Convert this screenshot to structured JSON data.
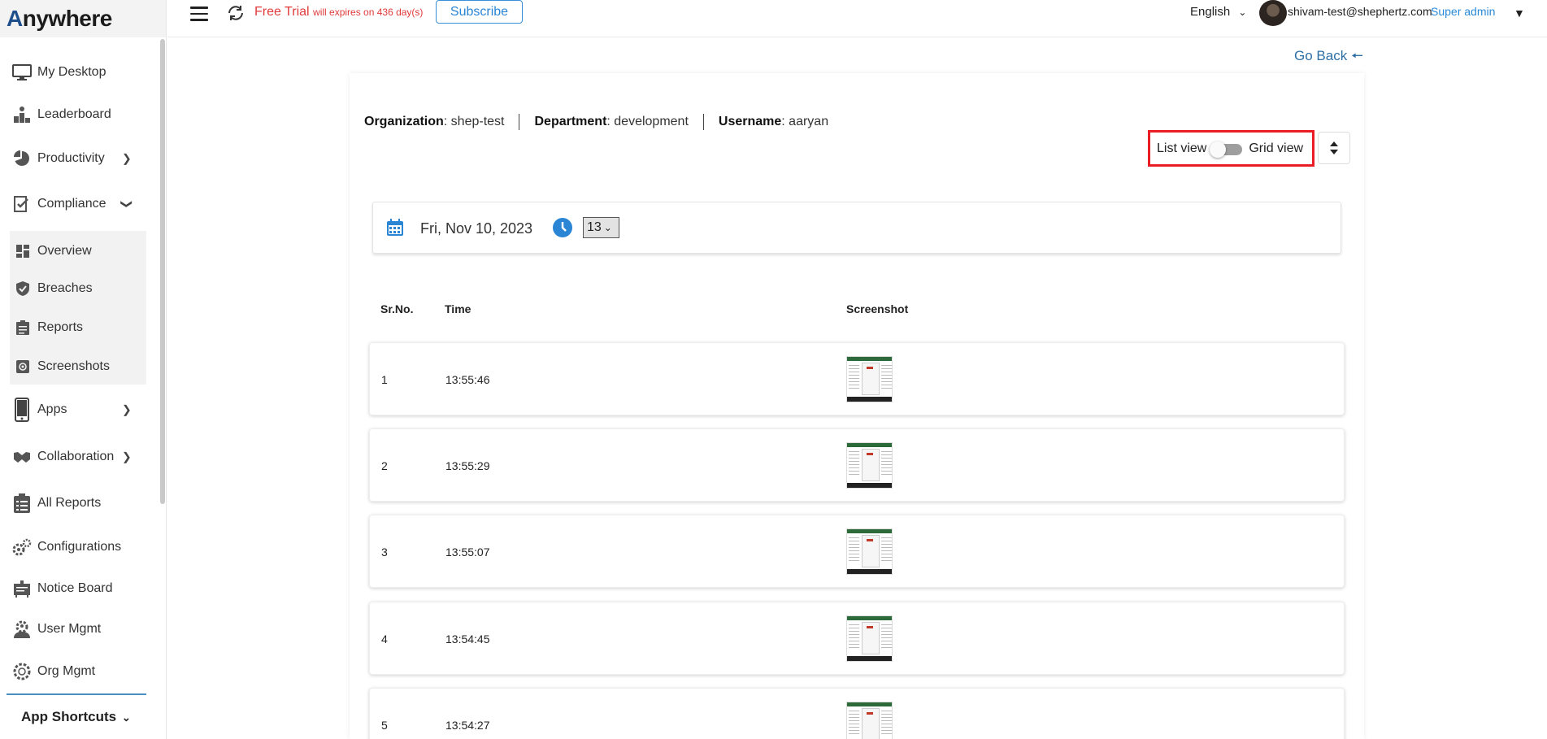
{
  "brand": {
    "logo_text": "nywhere",
    "logo_initial": "A"
  },
  "topbar": {
    "trial_label": "Free Trial",
    "trial_note": "will expires on 436 day(s)",
    "subscribe_label": "Subscribe",
    "language": "English",
    "user_email": "shivam-test@shephertz.com",
    "user_role": "Super admin"
  },
  "sidebar": {
    "items": [
      {
        "label": "My Desktop"
      },
      {
        "label": "Leaderboard"
      },
      {
        "label": "Productivity"
      },
      {
        "label": "Compliance"
      },
      {
        "label": "Apps"
      },
      {
        "label": "Collaboration"
      },
      {
        "label": "All Reports"
      },
      {
        "label": "Configurations"
      },
      {
        "label": "Notice Board"
      },
      {
        "label": "User Mgmt"
      },
      {
        "label": "Org Mgmt"
      }
    ],
    "compliance_sub": [
      {
        "label": "Overview"
      },
      {
        "label": "Breaches"
      },
      {
        "label": "Reports"
      },
      {
        "label": "Screenshots"
      }
    ],
    "shortcuts_label": "App Shortcuts"
  },
  "page": {
    "go_back": "Go Back",
    "organization_label": "Organization",
    "organization_value": ": shep-test",
    "department_label": "Department",
    "department_value": ": development",
    "username_label": "Username",
    "username_value": ": aaryan",
    "list_view_label": "List view",
    "grid_view_label": "Grid view",
    "date": "Fri, Nov 10, 2023",
    "hour": "13"
  },
  "table": {
    "headers": {
      "no": "Sr.No.",
      "time": "Time",
      "screenshot": "Screenshot"
    },
    "rows": [
      {
        "no": "1",
        "time": "13:55:46"
      },
      {
        "no": "2",
        "time": "13:55:29"
      },
      {
        "no": "3",
        "time": "13:55:07"
      },
      {
        "no": "4",
        "time": "13:54:45"
      },
      {
        "no": "5",
        "time": "13:54:27"
      }
    ]
  },
  "colors": {
    "accent": "#2a85d4",
    "alert": "#e03a3a",
    "highlight_border": "#ea1d24"
  }
}
